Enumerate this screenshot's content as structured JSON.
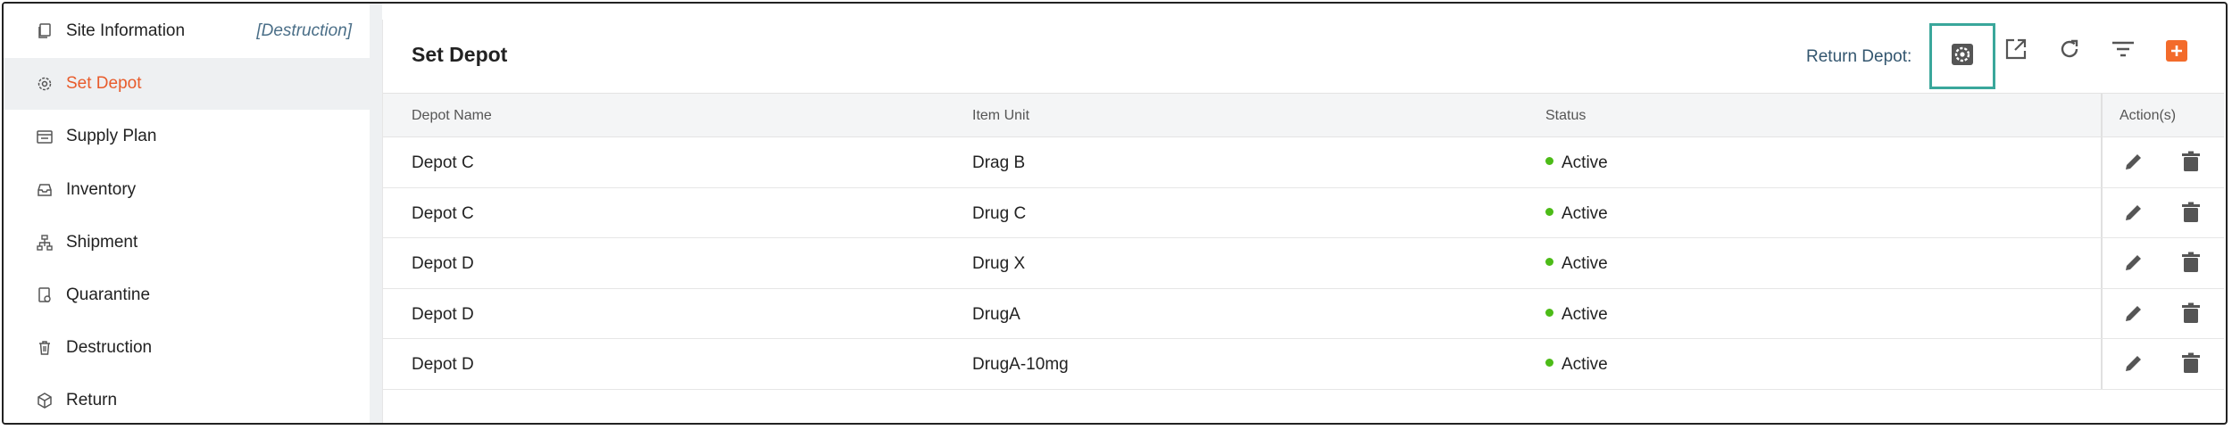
{
  "sidebar": {
    "items": [
      {
        "label": "Site Information",
        "tag": "[Destruction]",
        "icon": "copy-icon"
      },
      {
        "label": "Set Depot",
        "icon": "gear-icon",
        "active": true
      },
      {
        "label": "Supply Plan",
        "icon": "calendar-icon"
      },
      {
        "label": "Inventory",
        "icon": "inbox-icon"
      },
      {
        "label": "Shipment",
        "icon": "network-icon"
      },
      {
        "label": "Quarantine",
        "icon": "quarantine-doc-icon"
      },
      {
        "label": "Destruction",
        "icon": "trash-outline-icon"
      },
      {
        "label": "Return",
        "icon": "box-icon"
      }
    ]
  },
  "header": {
    "title": "Set Depot",
    "return_depot_label": "Return Depot:",
    "toolbar": [
      "return-depot-settings-icon",
      "open-external-icon",
      "refresh-icon",
      "filter-icon",
      "add-icon"
    ]
  },
  "table": {
    "columns": [
      "Depot Name",
      "Item Unit",
      "Status",
      "Action(s)"
    ],
    "rows": [
      {
        "depot": "Depot C",
        "item": "Drag B",
        "status": "Active"
      },
      {
        "depot": "Depot C",
        "item": "Drug C",
        "status": "Active"
      },
      {
        "depot": "Depot D",
        "item": "Drug X",
        "status": "Active"
      },
      {
        "depot": "Depot D",
        "item": "DrugA",
        "status": "Active"
      },
      {
        "depot": "Depot D",
        "item": "DrugA-10mg",
        "status": "Active"
      }
    ]
  },
  "colors": {
    "accent": "#e85c2c",
    "active_status": "#4cbb17",
    "highlight_border": "#3aa79b",
    "add_button": "#f36b2b"
  }
}
